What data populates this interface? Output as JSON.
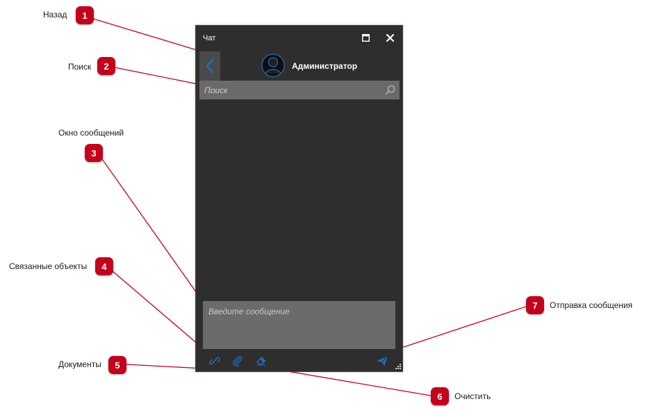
{
  "window": {
    "title": "Чат",
    "user_name": "Администратор",
    "search_placeholder": "Поиск",
    "compose_placeholder": "Введите сообщение"
  },
  "callouts": [
    {
      "num": "1",
      "label": "Назад"
    },
    {
      "num": "2",
      "label": "Поиск"
    },
    {
      "num": "3",
      "label": "Окно сообщений"
    },
    {
      "num": "4",
      "label": "Связанные объекты"
    },
    {
      "num": "5",
      "label": "Документы"
    },
    {
      "num": "6",
      "label": "Очистить"
    },
    {
      "num": "7",
      "label": "Отправка сообщения"
    }
  ],
  "icons": {
    "back": "chevron-left-icon",
    "maximize": "maximize-icon",
    "close": "close-icon",
    "avatar": "user-avatar-icon",
    "search": "search-icon",
    "link": "link-icon",
    "attach": "paperclip-icon",
    "clear": "eraser-icon",
    "send": "send-icon",
    "resize": "resize-grip-icon"
  },
  "colors": {
    "window_bg": "#2e2e2e",
    "field_bg": "#6b6b6b",
    "accent_blue": "#1f6fbf",
    "callout_red": "#c4001a",
    "leader_line": "#c4001a"
  }
}
